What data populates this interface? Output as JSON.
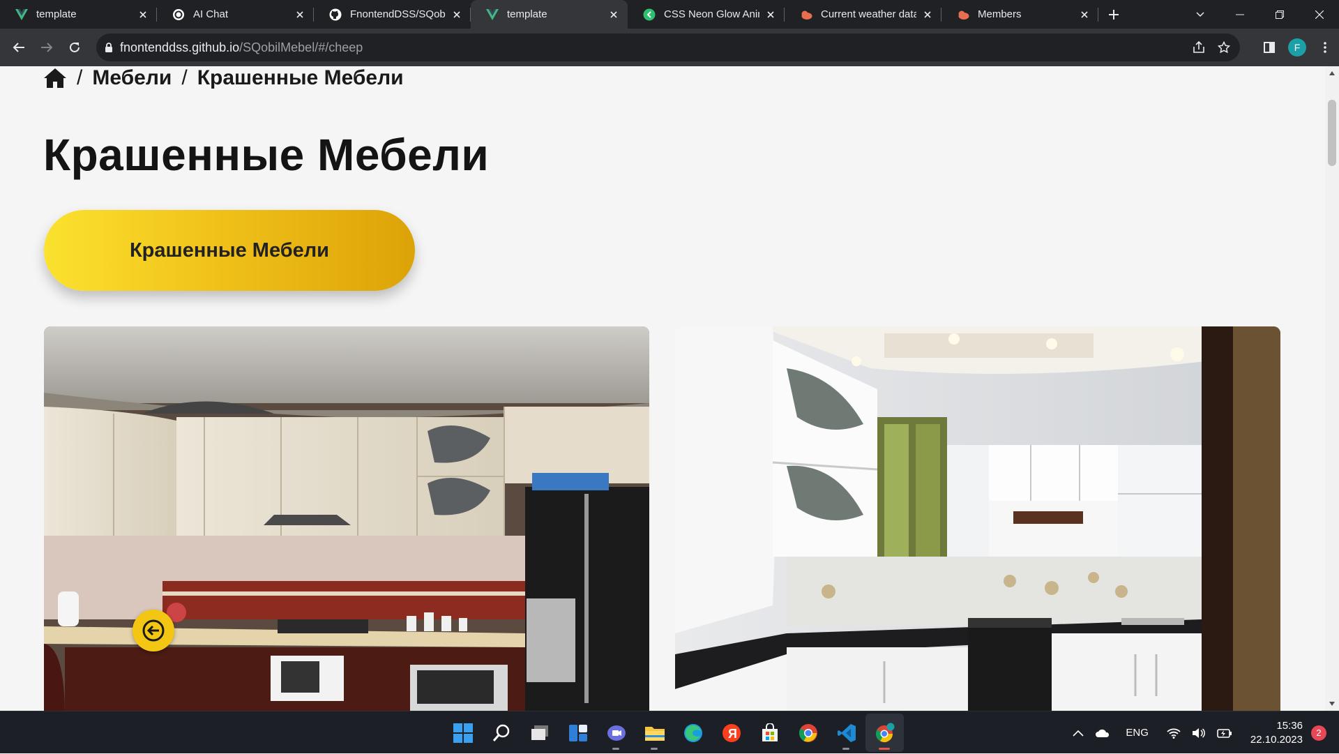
{
  "browser": {
    "tabs": [
      {
        "title": "template",
        "icon": "vue-icon",
        "active": false
      },
      {
        "title": "AI Chat",
        "icon": "ai-chat-icon",
        "active": false
      },
      {
        "title": "FnontendDSS/SQobil",
        "icon": "github-icon",
        "active": false
      },
      {
        "title": "template",
        "icon": "vue-icon",
        "active": true
      },
      {
        "title": "CSS Neon Glow Anim",
        "icon": "codepen-icon",
        "active": false
      },
      {
        "title": "Current weather data",
        "icon": "openweather-icon",
        "active": false
      },
      {
        "title": "Members",
        "icon": "openweather-icon",
        "active": false
      }
    ],
    "url_host": "fnontenddss.github.io",
    "url_path": "/SQobilMebel/#/cheep",
    "profile_initial": "F"
  },
  "page": {
    "breadcrumb": [
      "Мебели",
      "Крашенные Мебели"
    ],
    "title": "Крашенные Мебели",
    "category_button": "Крашенные Мебели",
    "images": [
      {
        "name": "kitchen-photo-beige"
      },
      {
        "name": "kitchen-photo-white"
      }
    ]
  },
  "taskbar": {
    "apps": [
      "start-icon",
      "search-icon",
      "task-view-icon",
      "widgets-icon",
      "chat-icon",
      "file-explorer-icon",
      "edge-icon",
      "yandex-icon",
      "store-icon",
      "chrome-icon",
      "vscode-icon",
      "chrome-profile-icon"
    ],
    "language": "ENG",
    "time": "15:36",
    "date": "22.10.2023",
    "notifications": "2"
  },
  "colors": {
    "accent_yellow": "#f1c21a",
    "tab_bg": "#202124",
    "toolbar_bg": "#35363a",
    "page_bg": "#f5f5f5"
  }
}
